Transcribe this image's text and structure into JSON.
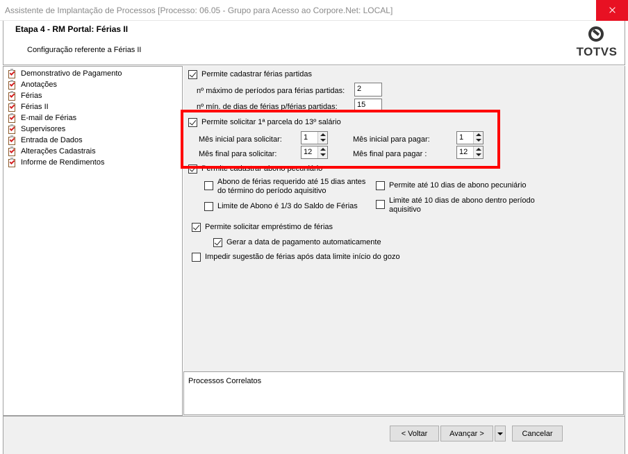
{
  "window": {
    "title": "Assistente de Implantação de Processos [Processo: 06.05 - Grupo para Acesso ao Corpore.Net: LOCAL]"
  },
  "header": {
    "step_title": "Etapa 4 - RM Portal: Férias II",
    "step_subtitle": "Configuração referente a Férias II",
    "logo_text": "TOTVS"
  },
  "tree": {
    "items": [
      {
        "label": "Demonstrativo de Pagamento"
      },
      {
        "label": "Anotações"
      },
      {
        "label": "Férias"
      },
      {
        "label": "Férias II"
      },
      {
        "label": "E-mail de Férias"
      },
      {
        "label": "Supervisores"
      },
      {
        "label": "Entrada de Dados"
      },
      {
        "label": "Alterações Cadastrais"
      },
      {
        "label": "Informe de Rendimentos"
      }
    ]
  },
  "form": {
    "ferias_partidas": {
      "label": "Permite cadastrar férias partidas",
      "checked": true
    },
    "max_periodos": {
      "label": "nº máximo de períodos para férias partidas:",
      "value": "2"
    },
    "min_dias": {
      "label": "nº mín. de dias de férias p/férias partidas:",
      "value": "15"
    },
    "parcela13": {
      "label": "Permite solicitar 1ª parcela do 13º salário",
      "checked": true
    },
    "mes_inicial_solicitar": {
      "label": "Mês inicial para solicitar:",
      "value": "1"
    },
    "mes_final_solicitar": {
      "label": "Mês final para solicitar:",
      "value": "12"
    },
    "mes_inicial_pagar": {
      "label": "Mês inicial para pagar:",
      "value": "1"
    },
    "mes_final_pagar": {
      "label": "Mês final para pagar :",
      "value": "12"
    },
    "abono_pecuniario": {
      "label": "Permite cadastrar abono pecuniário",
      "checked": true
    },
    "abono_15_dias": {
      "label_line1": "Abono de férias requerido até 15 dias antes",
      "label_line2": "do término do período aquisitivo",
      "checked": false
    },
    "limite_abono": {
      "label": "Limite de Abono é 1/3 do Saldo de Férias",
      "checked": false
    },
    "permite_10_dias": {
      "label": "Permite até 10 dias de abono pecuniário",
      "checked": false
    },
    "limite_10_dias": {
      "label_line1": "Limite até 10 dias de abono dentro período",
      "label_line2": "aquisitivo",
      "checked": false
    },
    "emprestimo": {
      "label": "Permite solicitar empréstimo de férias",
      "checked": true
    },
    "gerar_data": {
      "label": "Gerar a data de pagamento automaticamente",
      "checked": true
    },
    "impedir_sugestao": {
      "label": "Impedir sugestão de férias após data limite início do gozo",
      "checked": false
    }
  },
  "related": {
    "title": "Processos Correlatos"
  },
  "footer": {
    "back_label": "< Voltar",
    "next_label": "Avançar >",
    "cancel_label": "Cancelar"
  }
}
